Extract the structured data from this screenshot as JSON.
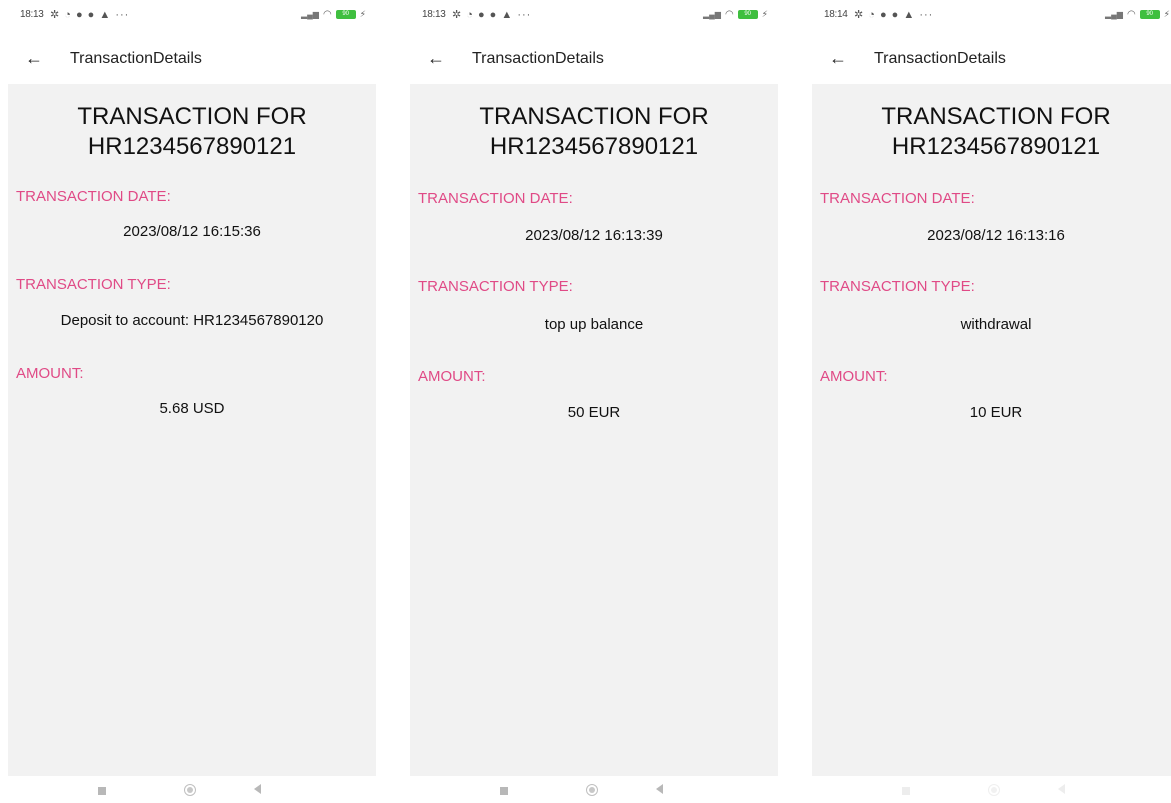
{
  "screens": [
    {
      "status": {
        "time": "18:13",
        "battery": "90"
      },
      "title": "TransactionDetails",
      "heading_line1": "TRANSACTION FOR",
      "heading_line2": "HR1234567890121",
      "date_label": "TRANSACTION DATE:",
      "date_value": "2023/08/12 16:15:36",
      "type_label": "TRANSACTION TYPE:",
      "type_value": "Deposit to account:  HR1234567890120",
      "amount_label": "AMOUNT:",
      "amount_value": "5.68 USD"
    },
    {
      "status": {
        "time": "18:13",
        "battery": "90"
      },
      "title": "TransactionDetails",
      "heading_line1": "TRANSACTION FOR",
      "heading_line2": "HR1234567890121",
      "date_label": "TRANSACTION DATE:",
      "date_value": "2023/08/12 16:13:39",
      "type_label": "TRANSACTION TYPE:",
      "type_value": "top up balance",
      "amount_label": "AMOUNT:",
      "amount_value": "50 EUR"
    },
    {
      "status": {
        "time": "18:14",
        "battery": "90"
      },
      "title": "TransactionDetails",
      "heading_line1": "TRANSACTION FOR",
      "heading_line2": "HR1234567890121",
      "date_label": "TRANSACTION DATE:",
      "date_value": "2023/08/12 16:13:16",
      "type_label": "TRANSACTION TYPE:",
      "type_value": "withdrawal",
      "amount_label": "AMOUNT:",
      "amount_value": "10 EUR"
    }
  ],
  "colors": {
    "label": "#e04a86",
    "content_bg": "#f2f2f2",
    "battery": "#3fbf3f"
  },
  "icons": {
    "back": "arrow-left-icon",
    "nav_recent": "square-icon",
    "nav_home": "circle-icon",
    "nav_back": "triangle-back-icon"
  }
}
